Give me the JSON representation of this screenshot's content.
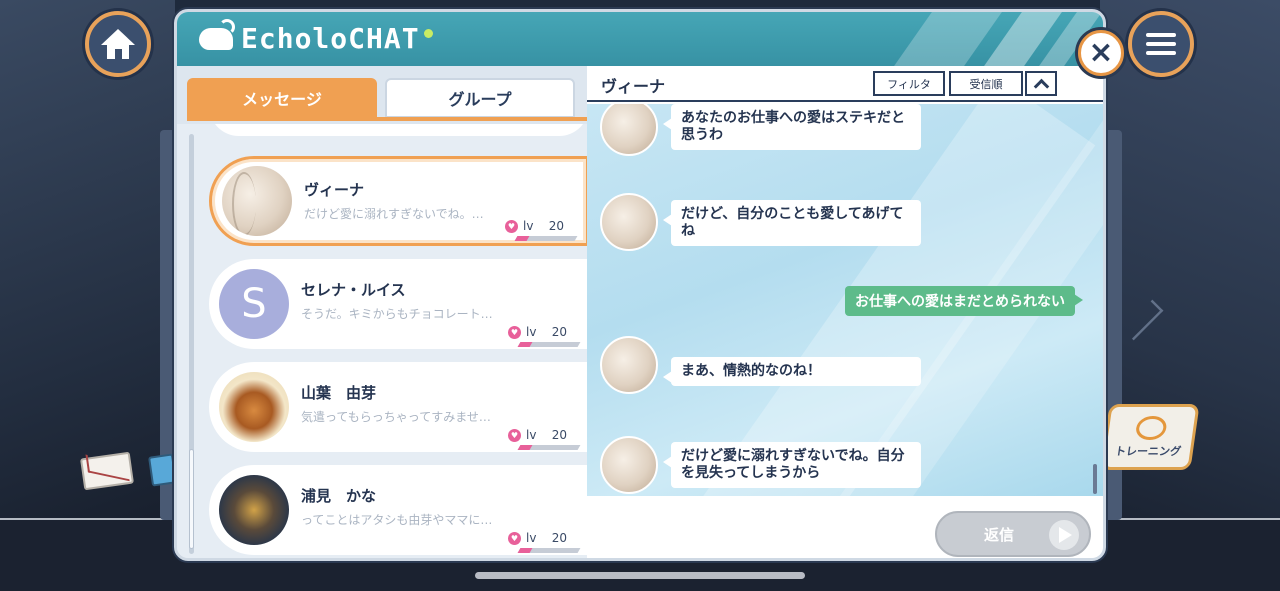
{
  "app": {
    "title": "EcholoCHAT"
  },
  "tabs": [
    {
      "label": "メッセージ",
      "active": true
    },
    {
      "label": "グループ",
      "active": false
    }
  ],
  "contacts": [
    {
      "name": "ヴィーナ",
      "preview": "だけど愛に溺れすぎないでね。…",
      "level_label": "lv",
      "level": "20",
      "selected": true,
      "avatar_icon": "character-portrait"
    },
    {
      "name": "セレナ・ルイス",
      "preview": "そうだ。キミからもチョコレート…",
      "level_label": "lv",
      "level": "20",
      "selected": false,
      "avatar_letter": "S"
    },
    {
      "name": "山葉　由芽",
      "preview": "気遣ってもらっちゃってすみませ…",
      "level_label": "lv",
      "level": "20",
      "selected": false,
      "avatar_icon": "skewer-food-photo"
    },
    {
      "name": "浦見　かな",
      "preview": "ってことはアタシも由芽やママに…",
      "level_label": "lv",
      "level": "20",
      "selected": false,
      "avatar_icon": "device-photo"
    }
  ],
  "chat": {
    "title": "ヴィーナ",
    "filter_label": "フィルタ",
    "order_label": "受信順",
    "messages": [
      {
        "from": "ヴィーナ",
        "direction": "in",
        "text": "あなたのお仕事への愛はステキだと思うわ"
      },
      {
        "from": "ヴィーナ",
        "direction": "in",
        "text": "だけど、自分のことも愛してあげてね"
      },
      {
        "from": "me",
        "direction": "out",
        "text": "お仕事への愛はまだとめられない"
      },
      {
        "from": "ヴィーナ",
        "direction": "in",
        "text": "まあ、情熱的なのね！"
      },
      {
        "from": "ヴィーナ",
        "direction": "in",
        "text": "だけど愛に溺れすぎないでね。自分を見失ってしまうから"
      }
    ],
    "reply_label": "返信",
    "reply_enabled": false
  },
  "hud": {
    "training_label": "トレーニング"
  },
  "colors": {
    "accent": "#f0a052",
    "titlebar": "#3792a4",
    "outgoing_bubble": "#5dbb8a",
    "text": "#253450"
  }
}
